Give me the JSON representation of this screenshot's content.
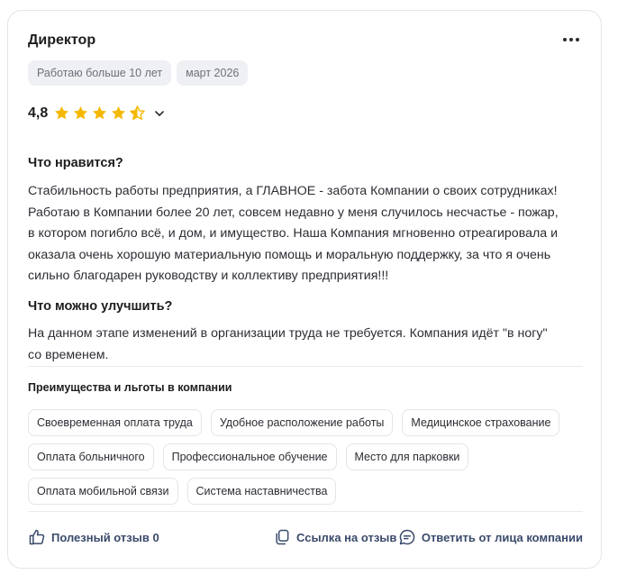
{
  "review": {
    "author_title": "Директор",
    "tags": [
      "Работаю больше 10 лет",
      "март 2026"
    ],
    "rating": "4,8",
    "rating_stars": 4.5,
    "pros_heading": "Что нравится?",
    "pros_text": "Стабильность работы предприятия, а ГЛАВНОЕ - забота Компании о своих сотрудниках!\nРаботаю в Компании более 20 лет, совсем недавно у меня случилось несчастье - пожар,\nв котором погибло всё, и дом, и имущество. Наша Компания мгновенно отреагировала и\nоказала очень хорошую материальную помощь и моральную поддержку, за что я очень\nсильно благодарен руководству и коллективу предприятия!!!",
    "cons_heading": "Что можно улучшить?",
    "cons_text": "На данном этапе изменений в организации труда не требуется. Компания идёт \"в ногу\"\nсо временем."
  },
  "benefits": {
    "title": "Преимущества и льготы в компании",
    "items": [
      "Своевременная оплата труда",
      "Удобное расположение работы",
      "Медицинское страхование",
      "Оплата больничного",
      "Профессиональное обучение",
      "Место для парковки",
      "Оплата мобильной связи",
      "Система наставничества"
    ]
  },
  "actions": {
    "useful_label": "Полезный отзыв 0",
    "link_label": "Ссылка на отзыв",
    "reply_label": "Ответить от лица компании"
  },
  "colors": {
    "star": "#f5b800",
    "action": "#3a4a6b",
    "chip_bg": "#eef0f3"
  }
}
